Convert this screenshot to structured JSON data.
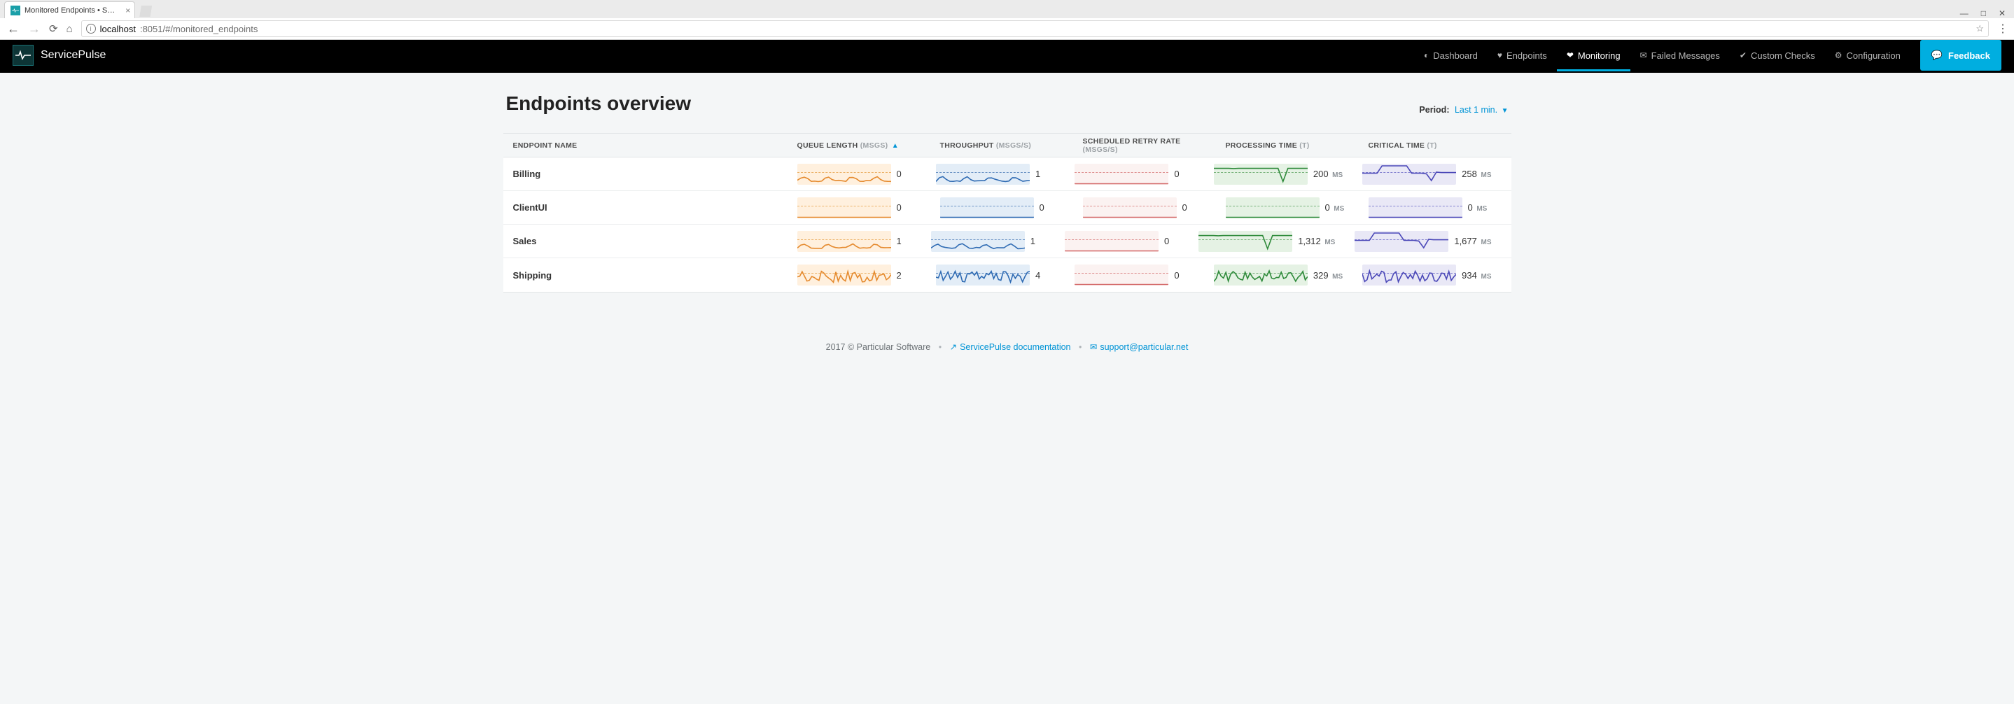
{
  "browser": {
    "tab_title": "Monitored Endpoints • S…",
    "url_host": "localhost",
    "url_port_path": ":8051/#/monitored_endpoints"
  },
  "brand": {
    "name": "ServicePulse"
  },
  "nav": {
    "dashboard": "Dashboard",
    "endpoints": "Endpoints",
    "monitoring": "Monitoring",
    "failed": "Failed Messages",
    "custom": "Custom Checks",
    "config": "Configuration",
    "feedback": "Feedback"
  },
  "page": {
    "title": "Endpoints overview",
    "period_label": "Period:",
    "period_value": "Last 1 min."
  },
  "columns": {
    "endpoint": "ENDPOINT NAME",
    "queue": "QUEUE LENGTH",
    "queue_unit": "(MSGS)",
    "throughput": "THROUGHPUT",
    "throughput_unit": "(MSGS/S)",
    "retry": "SCHEDULED RETRY RATE",
    "retry_unit": "(MSGS/S)",
    "proc": "PROCESSING TIME",
    "proc_unit": "(T)",
    "crit": "CRITICAL TIME",
    "crit_unit": "(T)"
  },
  "rows": [
    {
      "name": "Billing",
      "queue": "0",
      "throughput": "1",
      "retry": "0",
      "proc": "200",
      "proc_unit": "MS",
      "crit": "258",
      "crit_unit": "MS",
      "spark": {
        "queue": "wave",
        "throughput": "wave",
        "retry": "flat",
        "proc": "dip",
        "crit": "step"
      }
    },
    {
      "name": "ClientUI",
      "queue": "0",
      "throughput": "0",
      "retry": "0",
      "proc": "0",
      "proc_unit": "MS",
      "crit": "0",
      "crit_unit": "MS",
      "spark": {
        "queue": "flat",
        "throughput": "flat",
        "retry": "flat",
        "proc": "flat",
        "crit": "flat"
      }
    },
    {
      "name": "Sales",
      "queue": "1",
      "throughput": "1",
      "retry": "0",
      "proc": "1,312",
      "proc_unit": "MS",
      "crit": "1,677",
      "crit_unit": "MS",
      "spark": {
        "queue": "wave",
        "throughput": "wave",
        "retry": "flat",
        "proc": "dip",
        "crit": "step"
      }
    },
    {
      "name": "Shipping",
      "queue": "2",
      "throughput": "4",
      "retry": "0",
      "proc": "329",
      "proc_unit": "MS",
      "crit": "934",
      "crit_unit": "MS",
      "spark": {
        "queue": "noisy",
        "throughput": "noisy",
        "retry": "flat",
        "proc": "noisy",
        "crit": "noisy"
      }
    }
  ],
  "footer": {
    "copyright": "2017 © Particular Software",
    "doc_label": "ServicePulse documentation",
    "support_label": "support@particular.net"
  },
  "chart_data": {
    "type": "table",
    "description": "Sparkline metrics per endpoint over last 1 minute (approximate, read from mini-charts).",
    "columns": [
      "endpoint",
      "queue_length_msgs",
      "throughput_msgs_s",
      "scheduled_retry_rate_msgs_s",
      "processing_time_ms",
      "critical_time_ms"
    ],
    "rows": [
      [
        "Billing",
        0,
        1,
        0,
        200,
        258
      ],
      [
        "ClientUI",
        0,
        0,
        0,
        0,
        0
      ],
      [
        "Sales",
        1,
        1,
        0,
        1312,
        1677
      ],
      [
        "Shipping",
        2,
        4,
        0,
        329,
        934
      ]
    ]
  }
}
